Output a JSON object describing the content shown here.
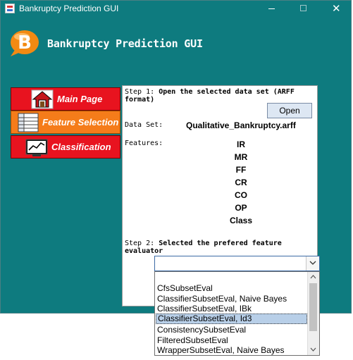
{
  "window": {
    "title": "Bankruptcy Prediction GUI",
    "controls": [
      "minimize",
      "maximize",
      "close"
    ]
  },
  "header": {
    "logo_letter": "B",
    "title": "Bankruptcy Prediction GUI"
  },
  "nav": {
    "items": [
      {
        "label": "Main Page",
        "icon": "house-icon",
        "active": false
      },
      {
        "label": "Feature Selection",
        "icon": "table-icon",
        "active": true
      },
      {
        "label": "Classification",
        "icon": "chart-icon",
        "active": false
      }
    ]
  },
  "panel": {
    "step1_num": "Step 1:",
    "step1_text": "Open the selected data set (ARFF format)",
    "open_label": "Open",
    "dataset_label": "Data Set:",
    "dataset_value": "Qualitative_Bankruptcy.arff",
    "features_label": "Features:",
    "features": [
      "IR",
      "MR",
      "FF",
      "CR",
      "CO",
      "OP",
      "Class"
    ],
    "step2_num": "Step 2:",
    "step2_text": "Selected the prefered feature evaluator"
  },
  "evaluator": {
    "selected_value": "",
    "options": [
      "",
      "CfsSubsetEval",
      "ClassifierSubsetEval, Naive Bayes",
      "ClassifierSubsetEval, IBk",
      "ClassifierSubsetEval, Id3",
      "ConsistencySubsetEval",
      "FilteredSubsetEval",
      "WrapperSubsetEval, Naive Bayes"
    ],
    "highlighted": "ClassifierSubsetEval, Id3"
  },
  "colors": {
    "background": "#0e7b7f",
    "nav_red": "#e8131f",
    "nav_orange": "#f57c1a",
    "logo_orange": "#f28a12"
  }
}
